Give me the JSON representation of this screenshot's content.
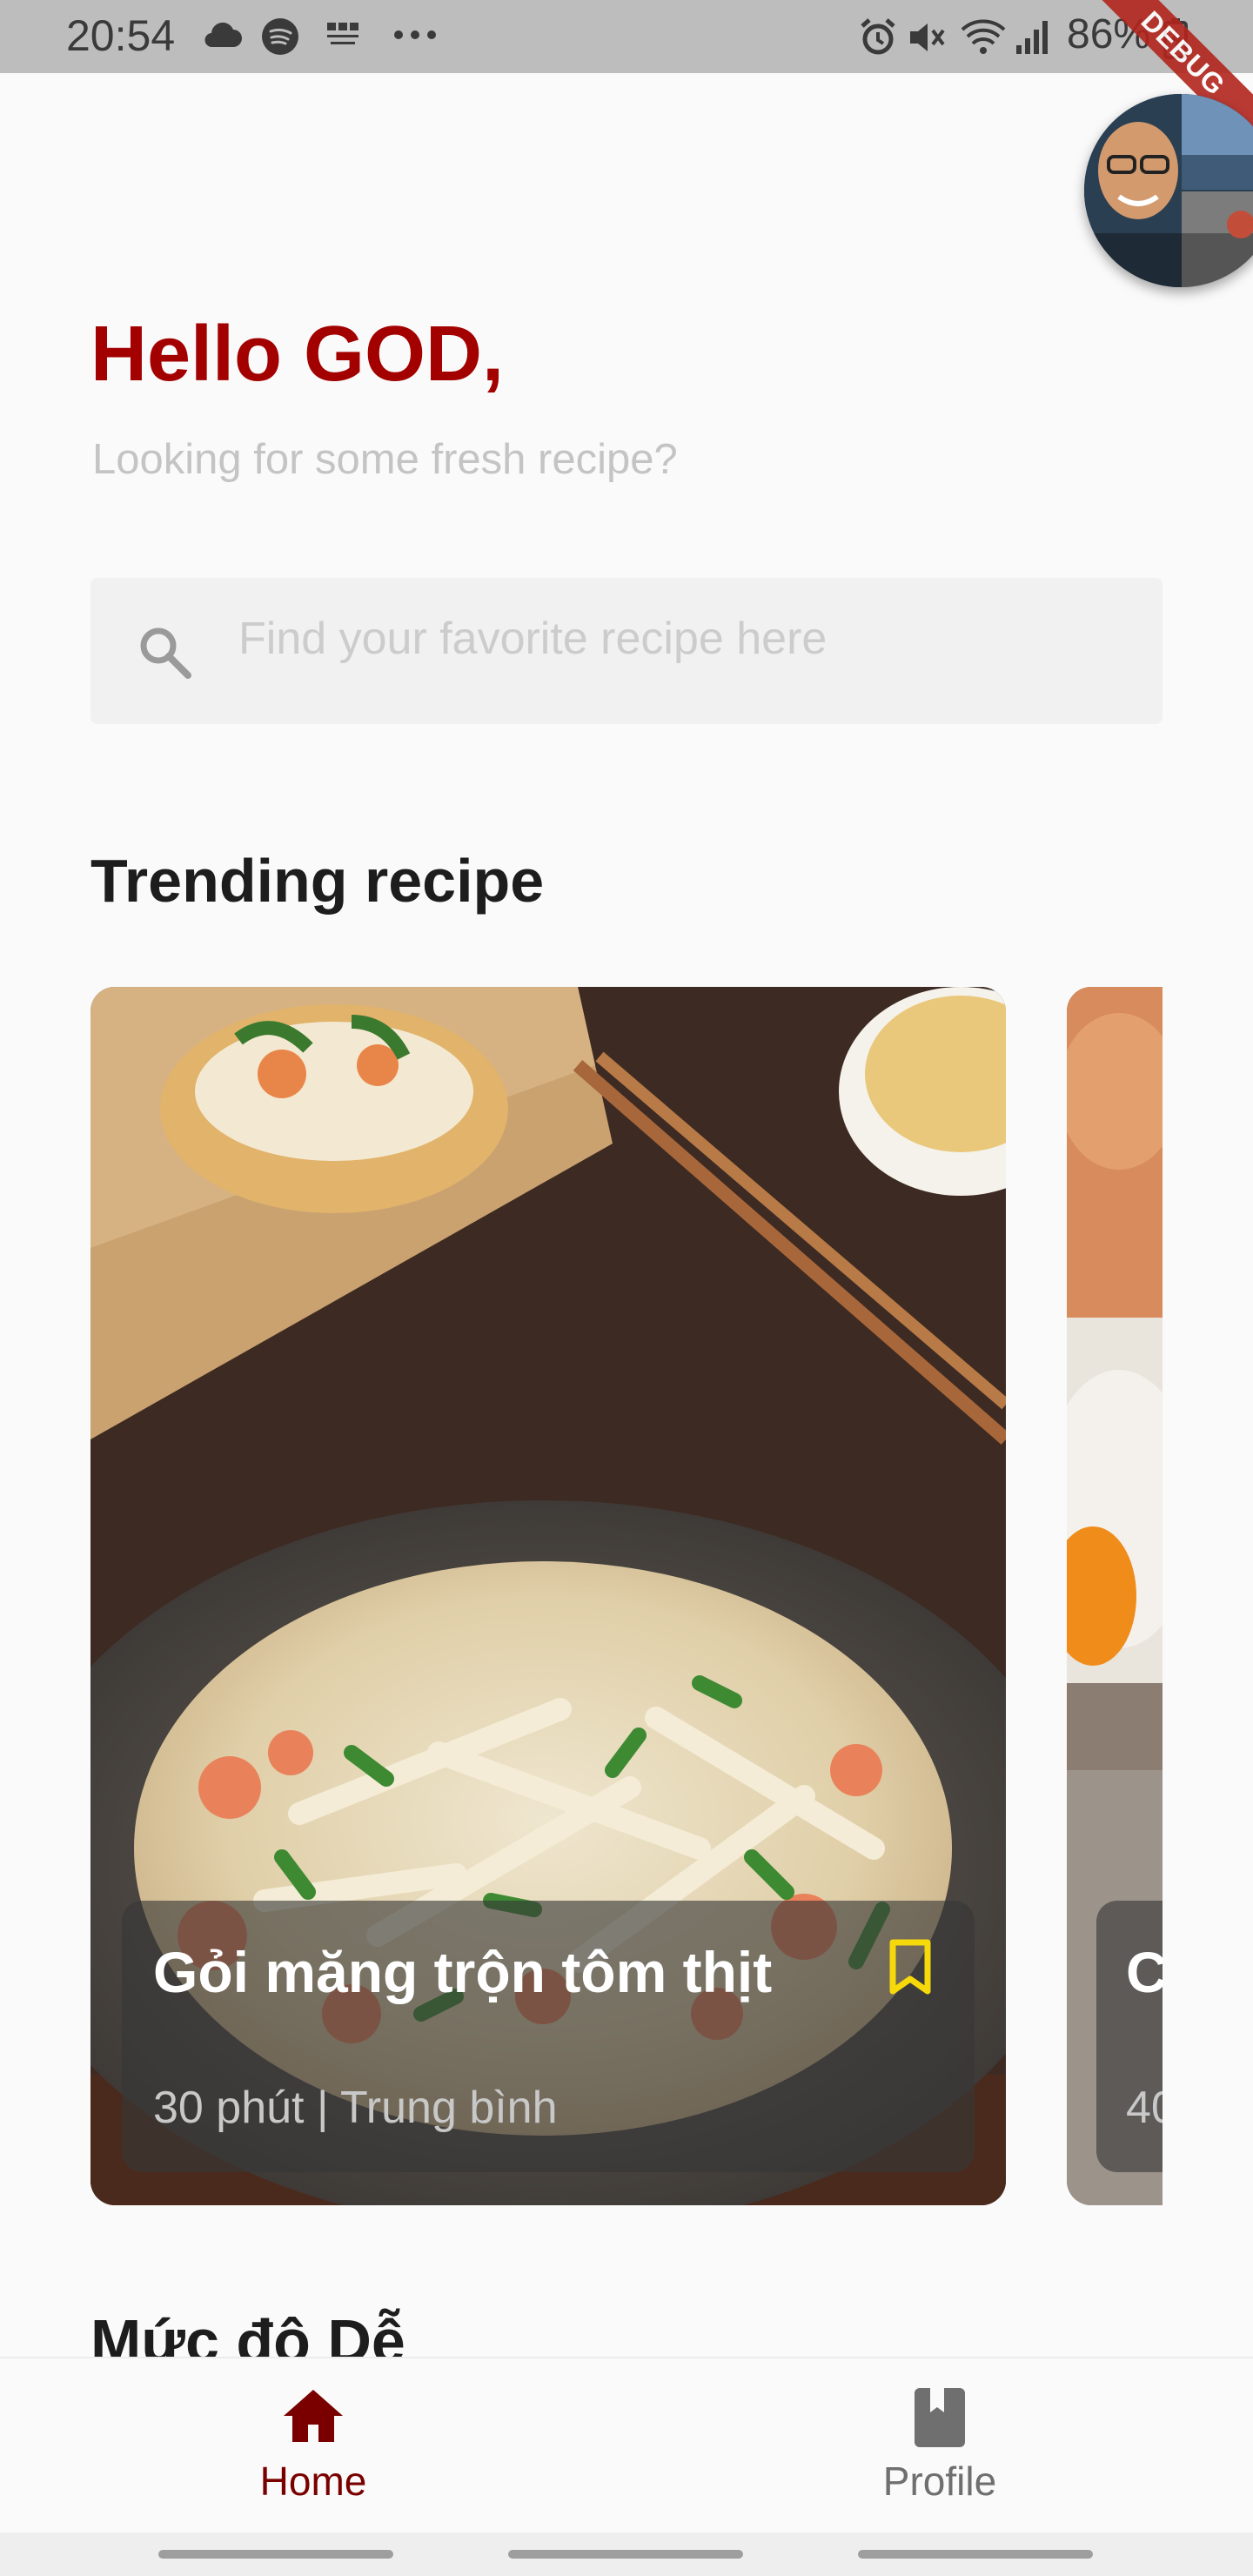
{
  "status_bar": {
    "time": "20:54",
    "battery": "86%",
    "left_icons": [
      "cloud-icon",
      "spotify-icon",
      "bbc-learning-english-icon",
      "more-notifications-icon"
    ],
    "right_icons": [
      "alarm-icon",
      "mute-icon",
      "wifi-icon",
      "signal-icon",
      "battery-charging-icon"
    ]
  },
  "debug_banner": "DEBUG",
  "header": {
    "greeting": "Hello GOD,",
    "subtitle": "Looking for some fresh recipe?"
  },
  "search": {
    "placeholder": "Find your favorite recipe here",
    "value": ""
  },
  "trending": {
    "title": "Trending recipe",
    "cards": [
      {
        "title": "Gỏi măng trộn tôm thịt",
        "meta": "30 phút | Trung bình",
        "bookmark_icon": "bookmark-outline-icon"
      },
      {
        "title": "C",
        "meta": "40"
      }
    ]
  },
  "next_section_title": "Mức độ Dễ",
  "bottom_nav": {
    "items": [
      {
        "label": "Home",
        "icon": "home-icon",
        "active": true
      },
      {
        "label": "Profile",
        "icon": "book-icon",
        "active": false
      }
    ]
  },
  "colors": {
    "accent": "#a30000",
    "nav_active": "#7a0000",
    "bookmark": "#f5d90a"
  }
}
